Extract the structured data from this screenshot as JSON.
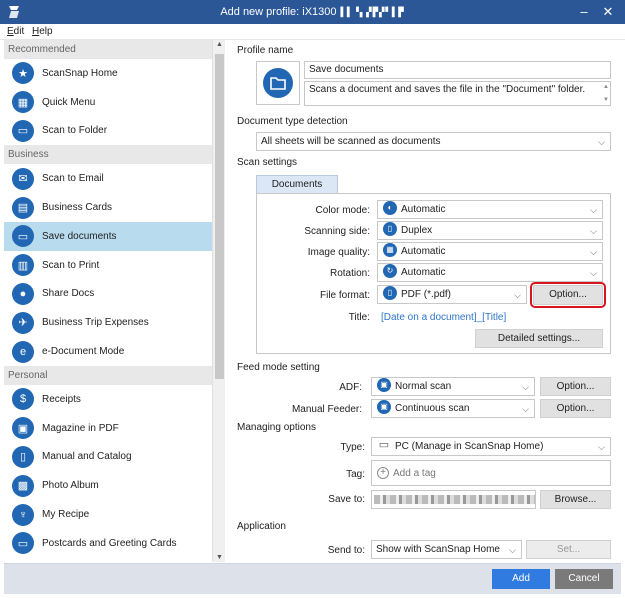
{
  "window": {
    "title": "Add new profile: iX1300",
    "title_suffix": "▌▌▝▖▞▛▞▘▌▛",
    "minimize": "–",
    "close": "✕"
  },
  "menu": [
    {
      "accel": "E",
      "rest": "dit"
    },
    {
      "accel": "H",
      "rest": "elp"
    }
  ],
  "sidebar": {
    "groups": [
      {
        "label": "Recommended",
        "items": [
          {
            "label": "ScanSnap Home",
            "icon": "star-icon",
            "glyph": "★"
          },
          {
            "label": "Quick Menu",
            "icon": "grid-icon",
            "glyph": "▦"
          },
          {
            "label": "Scan to Folder",
            "icon": "folder-icon",
            "glyph": "▭"
          }
        ]
      },
      {
        "label": "Business",
        "items": [
          {
            "label": "Scan to Email",
            "icon": "email-icon",
            "glyph": "✉"
          },
          {
            "label": "Business Cards",
            "icon": "business-card-icon",
            "glyph": "▤"
          },
          {
            "label": "Save documents",
            "icon": "folder-icon",
            "glyph": "▭",
            "selected": true
          },
          {
            "label": "Scan to Print",
            "icon": "print-icon",
            "glyph": "▥"
          },
          {
            "label": "Share Docs",
            "icon": "people-icon",
            "glyph": "●"
          },
          {
            "label": "Business Trip Expenses",
            "icon": "airplane-icon",
            "glyph": "✈"
          },
          {
            "label": "e-Document Mode",
            "icon": "e-document-icon",
            "glyph": "e"
          }
        ]
      },
      {
        "label": "Personal",
        "items": [
          {
            "label": "Receipts",
            "icon": "receipt-icon",
            "glyph": "$"
          },
          {
            "label": "Magazine in PDF",
            "icon": "magazine-icon",
            "glyph": "▣"
          },
          {
            "label": "Manual and Catalog",
            "icon": "book-icon",
            "glyph": "▯"
          },
          {
            "label": "Photo Album",
            "icon": "photo-icon",
            "glyph": "▩"
          },
          {
            "label": "My Recipe",
            "icon": "utensils-icon",
            "glyph": "♆"
          },
          {
            "label": "Postcards and Greeting Cards",
            "icon": "postcard-icon",
            "glyph": "▭"
          }
        ]
      }
    ]
  },
  "profile": {
    "section": "Profile name",
    "name": "Save documents",
    "description": "Scans a document and saves the file in the \"Document\" folder."
  },
  "detection": {
    "section": "Document type detection",
    "value": "All sheets will be scanned as documents"
  },
  "scan": {
    "section": "Scan settings",
    "tab": "Documents",
    "color_mode": {
      "label": "Color mode:",
      "value": "Automatic"
    },
    "scanning_side": {
      "label": "Scanning side:",
      "value": "Duplex"
    },
    "image_quality": {
      "label": "Image quality:",
      "value": "Automatic"
    },
    "rotation": {
      "label": "Rotation:",
      "value": "Automatic"
    },
    "file_format": {
      "label": "File format:",
      "value": "PDF (*.pdf)",
      "option": "Option..."
    },
    "title": {
      "label": "Title:",
      "value": "[Date on a document]_[Title]"
    },
    "detailed": "Detailed settings..."
  },
  "feed": {
    "section": "Feed mode setting",
    "adf": {
      "label": "ADF:",
      "value": "Normal scan",
      "option": "Option..."
    },
    "manual": {
      "label": "Manual Feeder:",
      "value": "Continuous scan",
      "option": "Option..."
    }
  },
  "managing": {
    "section": "Managing options",
    "type": {
      "label": "Type:",
      "value": "PC (Manage in ScanSnap Home)"
    },
    "tag": {
      "label": "Tag:",
      "placeholder": "Add a tag"
    },
    "save_to": {
      "label": "Save to:",
      "browse": "Browse..."
    }
  },
  "application": {
    "section": "Application",
    "send_to": {
      "label": "Send to:",
      "value": "Show with ScanSnap Home",
      "set": "Set..."
    }
  },
  "footer": {
    "add": "Add",
    "cancel": "Cancel"
  },
  "colors": {
    "titlebar": "#2b5797",
    "accent": "#2167b3",
    "selected": "#b8dcee",
    "highlight": "#d9141e"
  }
}
